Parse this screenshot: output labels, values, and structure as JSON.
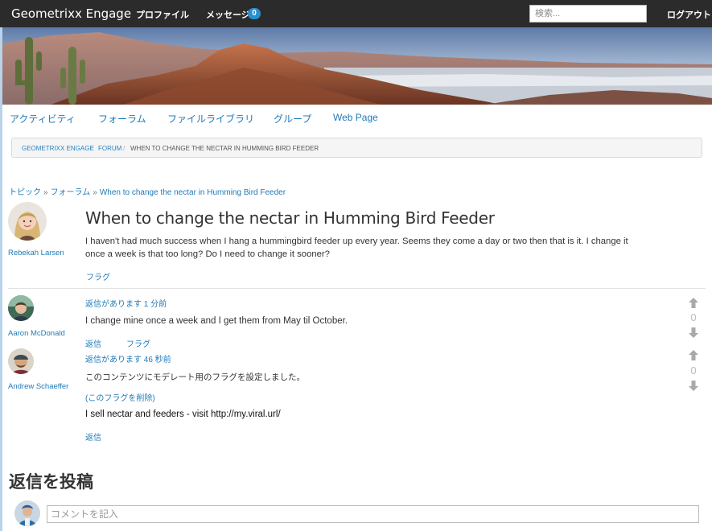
{
  "topbar": {
    "brand": "Geometrixx Engage",
    "profile": "プロファイル",
    "messages": "メッセージ",
    "message_count": "0",
    "search_placeholder": "検索...",
    "logout": "ログアウト"
  },
  "subnav": [
    "アクティビティ",
    "フォーラム",
    "ファイルライブラリ",
    "グループ",
    "Web Page"
  ],
  "breadcrumb": {
    "items": [
      "GEOMETRIXX ENGAGE",
      "FORUM"
    ],
    "separator": "/",
    "current": "WHEN TO CHANGE THE NECTAR IN HUMMING BIRD FEEDER"
  },
  "path": {
    "items": [
      "トピック",
      "フォーラム",
      "When to change the nectar in Humming Bird Feeder"
    ],
    "separator": "»"
  },
  "topic": {
    "author": "Rebekah Larsen",
    "title": "When to change the nectar in Humming Bird Feeder",
    "body": "I haven't had much success when I hang a hummingbird feeder up every year. Seems they come a day or two then that is it. I change it once a week is that too long? Do I need to change it sooner?",
    "flag": "フラグ"
  },
  "replies": [
    {
      "author": "Aaron McDonald",
      "meta": "返信があります 1 分前",
      "text": "I change mine once a week and I get them from May til October.",
      "reply_label": "返信",
      "flag_label": "フラグ",
      "votes": "0"
    },
    {
      "author": "Andrew Schaeffer",
      "meta": "返信があります 46 秒前",
      "moderation_note": "このコンテンツにモデレート用のフラグを設定しました。",
      "unflag_label": "(このフラグを削除)",
      "text": "I sell nectar and feeders - visit http://my.viral.url/",
      "reply_label": "返信",
      "votes": "0"
    }
  ],
  "post_reply": {
    "heading": "返信を投稿",
    "placeholder": "コメントを記入"
  },
  "colors": {
    "topbar": "#2b2b2b",
    "link": "#1f7ab8",
    "badge": "#2a8fce"
  }
}
